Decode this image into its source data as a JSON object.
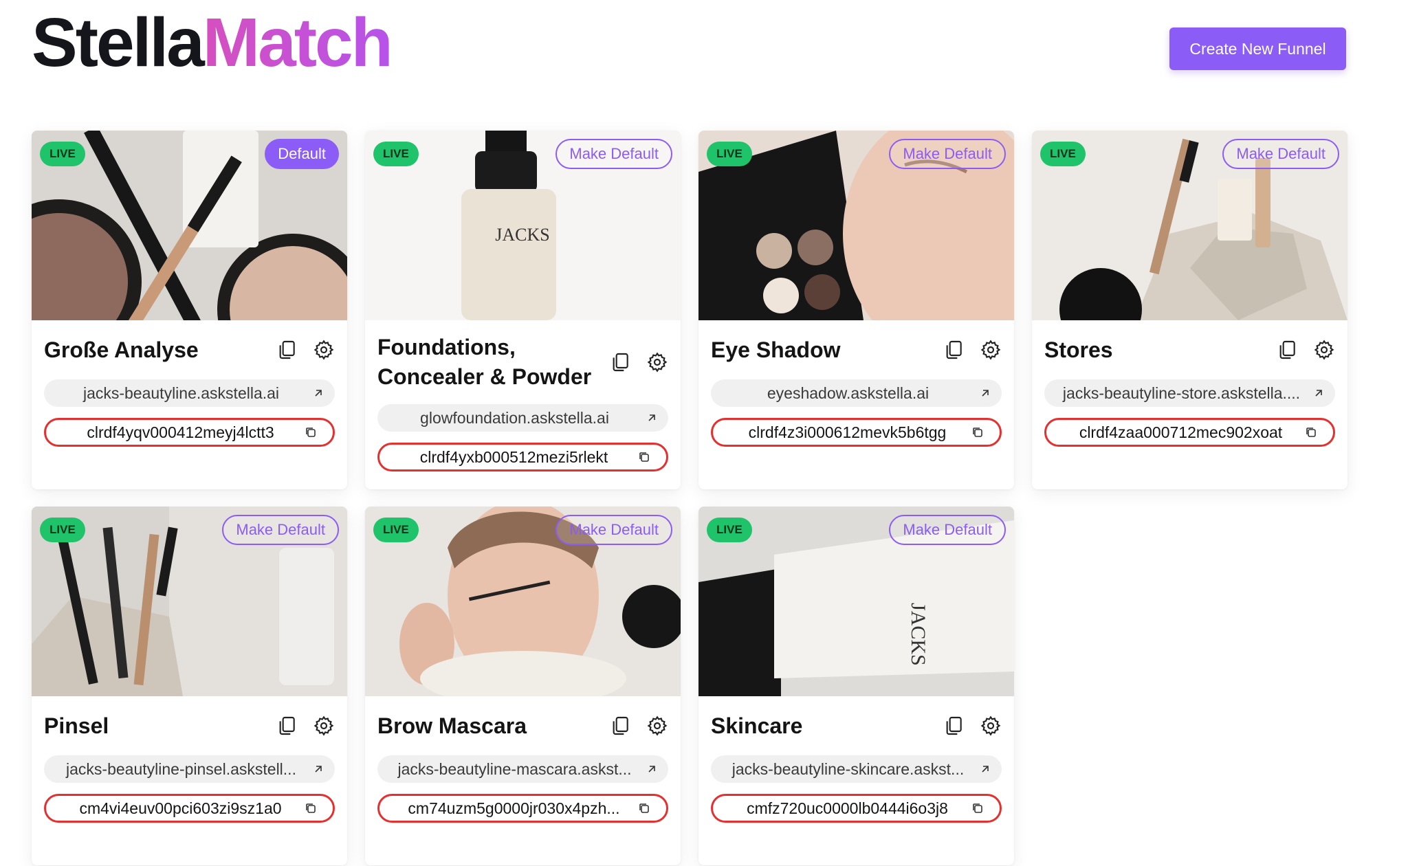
{
  "brand": {
    "part1": "Stella",
    "part2": "Match"
  },
  "header": {
    "create_label": "Create New Funnel"
  },
  "labels": {
    "live": "LIVE"
  },
  "colors": {
    "accent": "#8b5cf6",
    "live": "#1ec36a",
    "id_border": "#e53030",
    "brand_gradient_start": "#d64fbf"
  },
  "funnels": [
    {
      "title": "Große Analyse",
      "url": "jacks-beautyline.askstella.ai",
      "id": "clrdf4yqv000412meyj4lctt3",
      "default_label": "Default",
      "is_default": true,
      "image": "makeup-flatlay"
    },
    {
      "title": "Foundations, Concealer & Powder",
      "url": "glowfoundation.askstella.ai",
      "id": "clrdf4yxb000512mezi5rlekt",
      "default_label": "Make Default",
      "is_default": false,
      "image": "foundation-bottle"
    },
    {
      "title": "Eye Shadow",
      "url": "eyeshadow.askstella.ai",
      "id": "clrdf4z3i000612mevk5b6tgg",
      "default_label": "Make Default",
      "is_default": false,
      "image": "eyeshadow-face"
    },
    {
      "title": "Stores",
      "url": "jacks-beautyline-store.askstella....",
      "id": "clrdf4zaa000712mec902xoat",
      "default_label": "Make Default",
      "is_default": false,
      "image": "products-stones"
    },
    {
      "title": "Pinsel",
      "url": "jacks-beautyline-pinsel.askstell...",
      "id": "cm4vi4euv00pci603zi9sz1a0",
      "default_label": "Make Default",
      "is_default": false,
      "image": "brushes"
    },
    {
      "title": "Brow Mascara",
      "url": "jacks-beautyline-mascara.askst...",
      "id": "cm74uzm5g0000jr030x4pzh...",
      "default_label": "Make Default",
      "is_default": false,
      "image": "mascara-woman"
    },
    {
      "title": "Skincare",
      "url": "jacks-beautyline-skincare.askst...",
      "id": "cmfz720uc0000lb0444i6o3j8",
      "default_label": "Make Default",
      "is_default": false,
      "image": "day-cream-tube"
    }
  ]
}
